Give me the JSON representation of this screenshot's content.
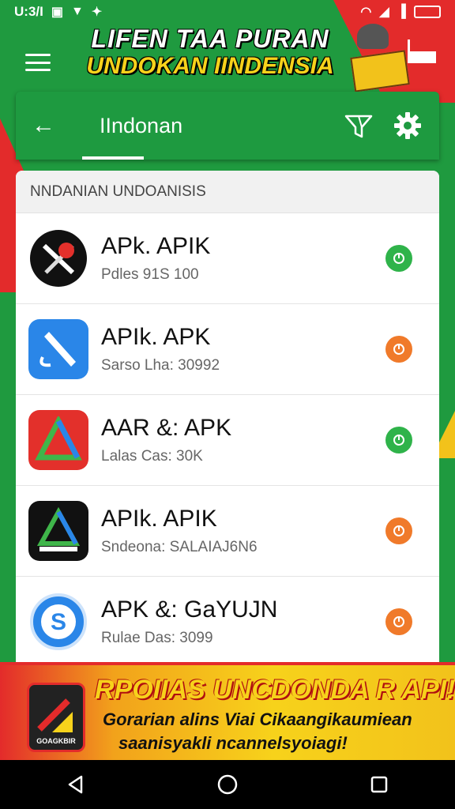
{
  "status_bar": {
    "time": "U:3/I",
    "left_icons": [
      "gallery-icon",
      "wifi-icon",
      "notification-icon"
    ],
    "right_icons": [
      "wifi-icon",
      "signal-icon",
      "signal-icon",
      "battery-icon"
    ]
  },
  "banner": {
    "line1": "LIFEN TAA PURAN",
    "line2": "UNDOKAN IINDENSIA"
  },
  "app_bar": {
    "title": "IIndonan",
    "back_icon": "arrow-back-icon",
    "filter_icon": "filter-icon",
    "settings_icon": "settings-icon"
  },
  "list": {
    "header": "NNDANIAN UNDOANISIS",
    "items": [
      {
        "name": "APk. APIK",
        "meta": "Pdles 91S 100",
        "icon": "tools-icon",
        "icon_bg": "#111111",
        "status_color": "#2fb34a"
      },
      {
        "name": "APIk. APK",
        "meta": "Sarso Lha: 30992",
        "icon": "pen-icon",
        "icon_bg": "#2a86e8",
        "status_color": "#f07a2a"
      },
      {
        "name": "AAR &: APK",
        "meta": "Lalas Cas: 30K",
        "icon": "triangle-logo-icon",
        "icon_bg": "#e3302b",
        "status_color": "#2fb34a"
      },
      {
        "name": "APIk. APIK",
        "meta": "Sndeona: SALAIAJ6N6",
        "icon": "triangle-logo-icon",
        "icon_bg": "#111111",
        "status_color": "#f07a2a"
      },
      {
        "name": "APK &: GaYUJN",
        "meta": "Rulae Das: 3099",
        "icon": "s-logo-icon",
        "icon_bg": "#ffffff",
        "status_color": "#f07a2a"
      }
    ]
  },
  "promo": {
    "headline": "RPOIIAS UNCDONDA R API!",
    "sub1": "Gorarian alins Viai Cikaangikaumiean",
    "sub2": "saanisyakli ncannelsyoiagi!",
    "logo_label": "GOAGKBIR"
  },
  "nav_bar": {
    "buttons": [
      "back-icon",
      "home-icon",
      "recents-icon"
    ]
  },
  "colors": {
    "primary_green": "#1e9a40",
    "accent_red": "#e32b2b",
    "accent_yellow": "#f7d21b"
  }
}
